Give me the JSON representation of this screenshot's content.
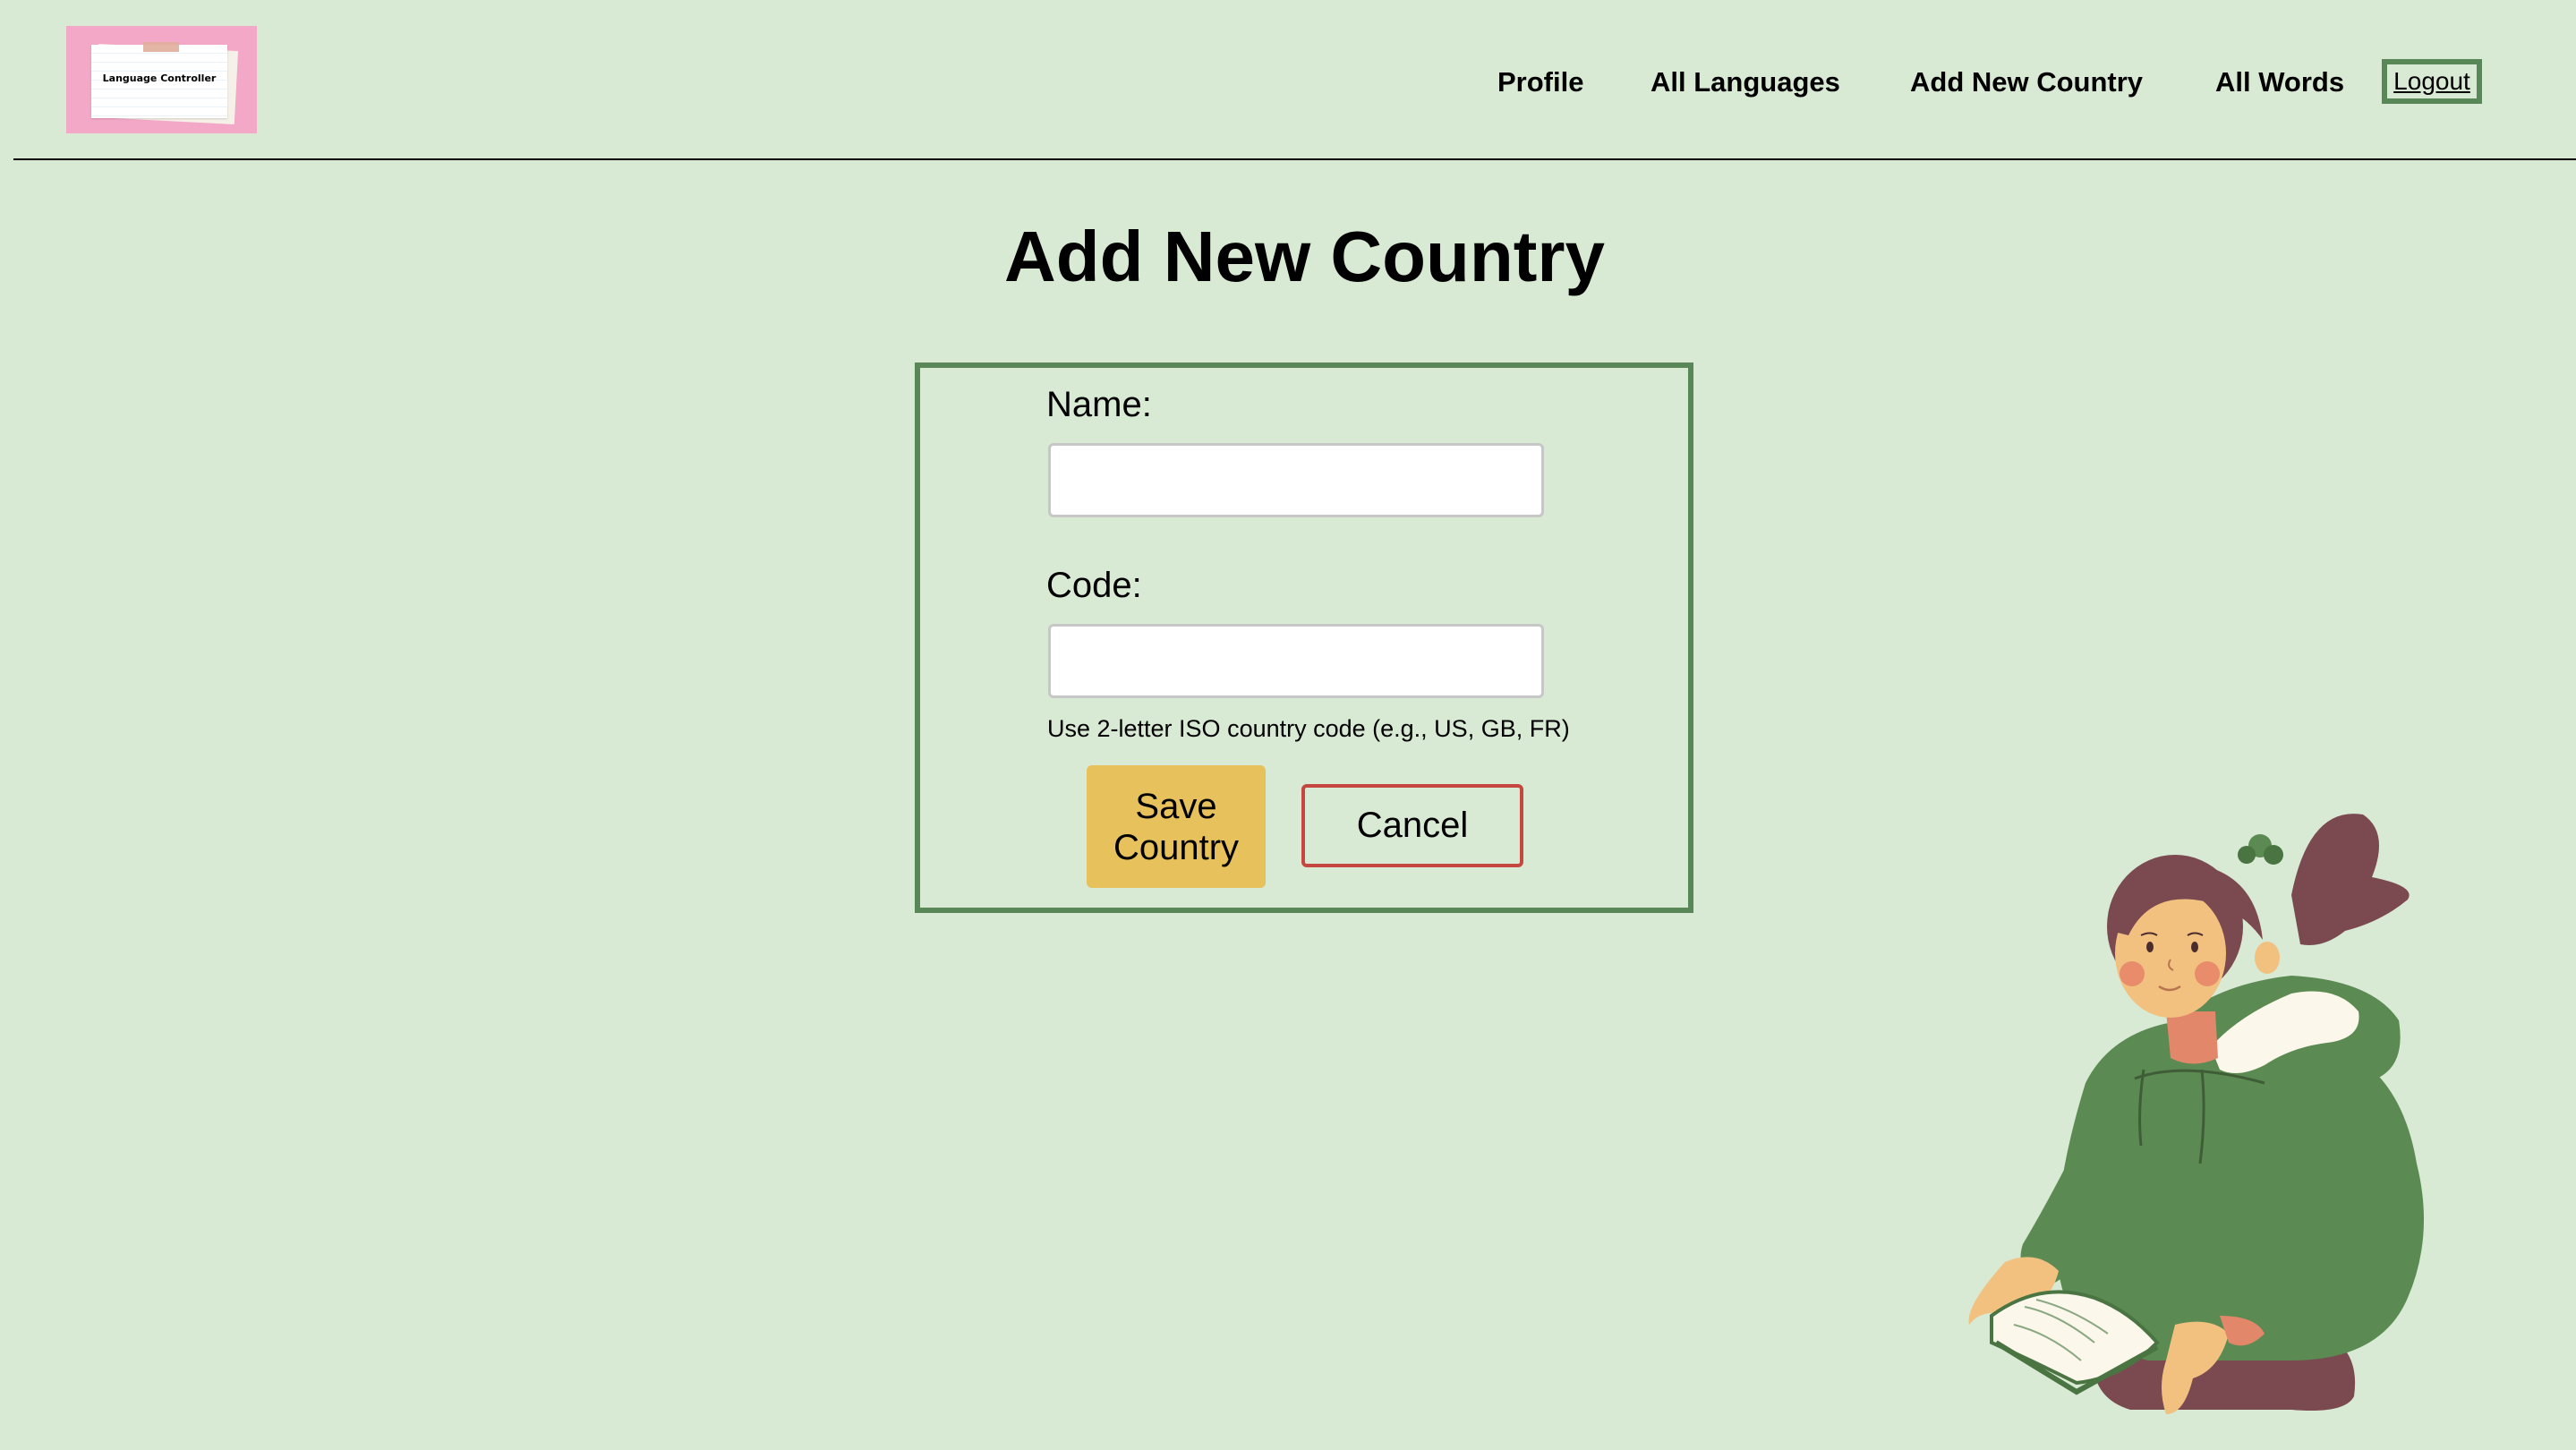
{
  "logo": {
    "text": "Language Controller"
  },
  "nav": {
    "items": [
      {
        "label": "Profile"
      },
      {
        "label": "All Languages"
      },
      {
        "label": "Add New Country"
      },
      {
        "label": "All Words"
      }
    ],
    "logout_label": "Logout"
  },
  "page": {
    "title": "Add New Country"
  },
  "form": {
    "name_label": "Name:",
    "name_value": "",
    "code_label": "Code:",
    "code_value": "",
    "code_hint": "Use 2-letter ISO country code (e.g., US, GB, FR)",
    "save_label": "Save Country",
    "cancel_label": "Cancel"
  },
  "colors": {
    "background": "#d8e9d4",
    "form_border": "#5a8757",
    "save_button": "#e6c15c",
    "cancel_border": "#c5473f",
    "logo_background": "#f3a8c7"
  }
}
